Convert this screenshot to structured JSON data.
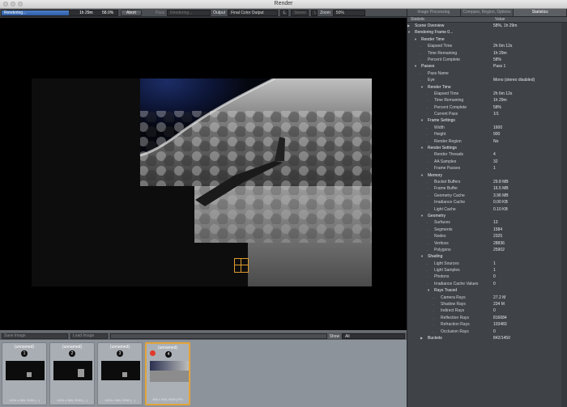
{
  "window": {
    "title": "Render"
  },
  "toolbar": {
    "status": "Rendering...",
    "time": "1h 29m",
    "percent": "58.0%",
    "progress_fraction": 0.58,
    "abort": "Abort",
    "pass_label": "Pass",
    "pass_value": "Rendering...",
    "output_label": "Output",
    "output_value": "Final Color Output",
    "channel_value": "L",
    "stereo_value": "Stereo",
    "stereo_extra": "L",
    "zoom_label": "Zoom",
    "zoom_value": "50%"
  },
  "strip": {
    "save_image": "Save Image",
    "load_image": "Load Image",
    "show_label": "Show",
    "show_value": "All"
  },
  "thumbnails": [
    {
      "name": "(unnamed)",
      "num": "1",
      "caption": "1024 x 384, RGB (...)",
      "active": false
    },
    {
      "name": "(unnamed)",
      "num": "2",
      "caption": "1024 x 384, RGB (...)",
      "active": false
    },
    {
      "name": "(unnamed)",
      "num": "3",
      "caption": "1024 x 384, RGB (...)",
      "active": false
    },
    {
      "name": "(unnamed)",
      "num": "4",
      "caption": "900 x 900, RGB (FP)",
      "active": true
    }
  ],
  "panel": {
    "tabs": [
      {
        "label": "Image Processing",
        "active": false
      },
      {
        "label": "Compare, Region, Options",
        "active": false
      },
      {
        "label": "Statistics",
        "active": true
      }
    ],
    "col_statistic": "Statistic",
    "col_value": "Value",
    "rows": [
      {
        "d": 0,
        "t": "c",
        "k": "Scene Overview",
        "v": "58%, 1h 29m"
      },
      {
        "d": 0,
        "t": "o",
        "k": "Rendering Frame 0...",
        "v": ""
      },
      {
        "d": 1,
        "t": "o",
        "k": "Render Time",
        "v": ""
      },
      {
        "d": 2,
        "t": "",
        "k": "Elapsed Time",
        "v": "2h 6m 12s"
      },
      {
        "d": 2,
        "t": "",
        "k": "Time Remaining",
        "v": "1h 29m"
      },
      {
        "d": 2,
        "t": "",
        "k": "Percent Complete",
        "v": "58%"
      },
      {
        "d": 1,
        "t": "o",
        "k": "Passes",
        "v": "Pass 1"
      },
      {
        "d": 2,
        "t": "",
        "k": "Pass Name",
        "v": ""
      },
      {
        "d": 2,
        "t": "",
        "k": "Eye",
        "v": "Mono (stereo disabled)"
      },
      {
        "d": 2,
        "t": "o",
        "k": "Render Time",
        "v": ""
      },
      {
        "d": 3,
        "t": "",
        "k": "Elapsed Time",
        "v": "2h 6m 12s"
      },
      {
        "d": 3,
        "t": "",
        "k": "Time Remaining",
        "v": "1h 29m"
      },
      {
        "d": 3,
        "t": "",
        "k": "Percent Complete",
        "v": "58%"
      },
      {
        "d": 3,
        "t": "",
        "k": "Current Pass",
        "v": "1/1"
      },
      {
        "d": 2,
        "t": "o",
        "k": "Frame Settings",
        "v": ""
      },
      {
        "d": 3,
        "t": "",
        "k": "Width",
        "v": "1600"
      },
      {
        "d": 3,
        "t": "",
        "k": "Height",
        "v": "900"
      },
      {
        "d": 3,
        "t": "",
        "k": "Render Region",
        "v": "No"
      },
      {
        "d": 2,
        "t": "o",
        "k": "Render Settings",
        "v": ""
      },
      {
        "d": 3,
        "t": "",
        "k": "Render Threads",
        "v": "4"
      },
      {
        "d": 3,
        "t": "",
        "k": "AA Samples",
        "v": "32"
      },
      {
        "d": 3,
        "t": "",
        "k": "Frame Passes",
        "v": "1"
      },
      {
        "d": 2,
        "t": "o",
        "k": "Memory",
        "v": ""
      },
      {
        "d": 3,
        "t": "",
        "k": "Bucket Buffers",
        "v": "29.8 MB"
      },
      {
        "d": 3,
        "t": "",
        "k": "Frame Buffer",
        "v": "16.5 MB"
      },
      {
        "d": 3,
        "t": "",
        "k": "Geometry Cache",
        "v": "3.96 MB"
      },
      {
        "d": 3,
        "t": "",
        "k": "Irradiance Cache",
        "v": "0.00 KB"
      },
      {
        "d": 3,
        "t": "",
        "k": "Light Cache",
        "v": "0.10 KB"
      },
      {
        "d": 2,
        "t": "o",
        "k": "Geometry",
        "v": ""
      },
      {
        "d": 3,
        "t": "",
        "k": "Surfaces",
        "v": "13"
      },
      {
        "d": 3,
        "t": "",
        "k": "Segments",
        "v": "1584"
      },
      {
        "d": 3,
        "t": "",
        "k": "Nodes",
        "v": "2325"
      },
      {
        "d": 3,
        "t": "",
        "k": "Vertices",
        "v": "28836"
      },
      {
        "d": 3,
        "t": "",
        "k": "Polygons",
        "v": "25902"
      },
      {
        "d": 2,
        "t": "o",
        "k": "Shading",
        "v": ""
      },
      {
        "d": 3,
        "t": "",
        "k": "Light Sources",
        "v": "1"
      },
      {
        "d": 3,
        "t": "",
        "k": "Light Samples",
        "v": "1"
      },
      {
        "d": 3,
        "t": "",
        "k": "Photons",
        "v": "0"
      },
      {
        "d": 3,
        "t": "",
        "k": "Irradiance Cache Values",
        "v": "0"
      },
      {
        "d": 3,
        "t": "o",
        "k": "Rays Traced",
        "v": ""
      },
      {
        "d": 4,
        "t": "",
        "k": "Camera Rays",
        "v": "27.2 M"
      },
      {
        "d": 4,
        "t": "",
        "k": "Shadow Rays",
        "v": "234 M"
      },
      {
        "d": 4,
        "t": "",
        "k": "Indirect Rays",
        "v": "0"
      },
      {
        "d": 4,
        "t": "",
        "k": "Reflection Rays",
        "v": "816684"
      },
      {
        "d": 4,
        "t": "",
        "k": "Refraction Rays",
        "v": "103483"
      },
      {
        "d": 4,
        "t": "",
        "k": "Occlusion Rays",
        "v": "0"
      },
      {
        "d": 2,
        "t": "c",
        "k": "Buckets",
        "v": "842/1450"
      }
    ]
  }
}
